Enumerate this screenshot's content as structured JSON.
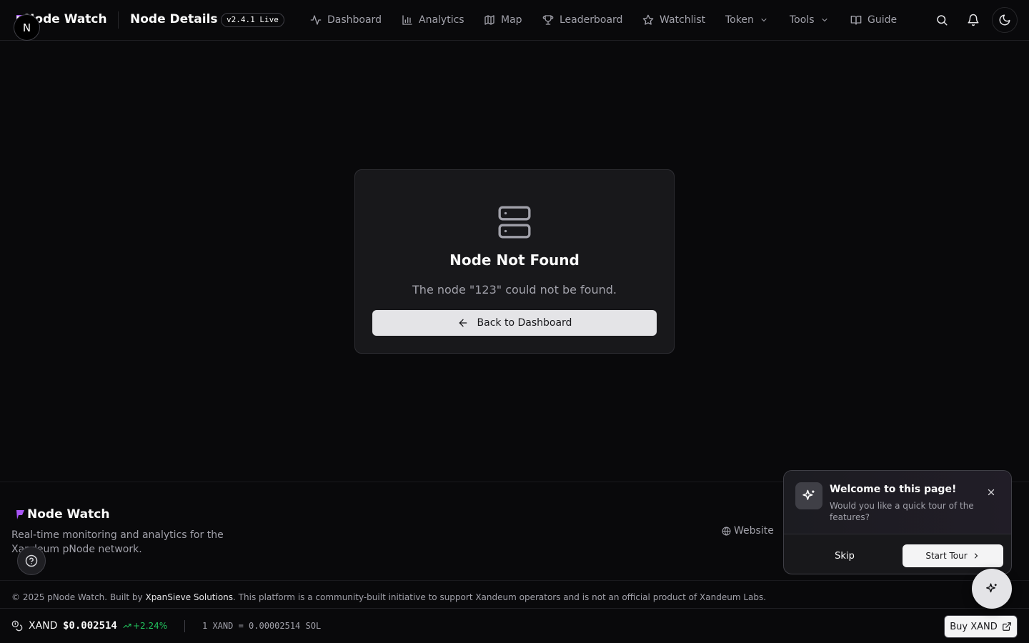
{
  "header": {
    "brand": "pNode Watch",
    "avatar_letter": "N",
    "page_title": "Node Details",
    "version_badge": "v2.4.1 Live",
    "nav": [
      {
        "label": "Dashboard",
        "icon": "activity-icon"
      },
      {
        "label": "Analytics",
        "icon": "bar-chart-icon"
      },
      {
        "label": "Map",
        "icon": "map-icon"
      },
      {
        "label": "Leaderboard",
        "icon": "trophy-icon"
      },
      {
        "label": "Watchlist",
        "icon": "star-icon"
      },
      {
        "label": "Token",
        "icon": "chevron-down-icon"
      },
      {
        "label": "Tools",
        "icon": "chevron-down-icon"
      },
      {
        "label": "Guide",
        "icon": "book-icon"
      }
    ],
    "actions": [
      "search-icon",
      "bell-icon",
      "moon-icon"
    ]
  },
  "main": {
    "card_icon": "server-icon",
    "title": "Node Not Found",
    "message": "The node \"123\" could not be found.",
    "back_button": "Back to Dashboard"
  },
  "footer": {
    "brand": "Node Watch",
    "description": "Real-time monitoring and analytics for the Xandeum pNode network.",
    "website_link": "Website",
    "copyright_prefix": "© 2025 pNode Watch. Built by ",
    "copyright_author": "XpanSieve Solutions",
    "copyright_suffix": ". This platform is a community-built initiative to support Xandeum operators and is not an official product of Xandeum Labs."
  },
  "ticker": {
    "symbol": "XAND",
    "price": "$0.002514",
    "change": "+2.24%",
    "rate": "1 XAND = 0.00002514 SOL",
    "buy_button": "Buy XAND"
  },
  "tour": {
    "title": "Welcome to this page!",
    "description": "Would you like a quick tour of the features?",
    "skip": "Skip",
    "start": "Start Tour"
  },
  "colors": {
    "background": "#09090b",
    "card": "#18181b",
    "accent": "#a855f7",
    "positive": "#22c55e"
  }
}
